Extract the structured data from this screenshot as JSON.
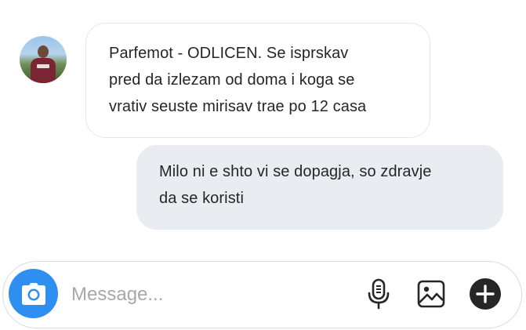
{
  "thread": {
    "messages": [
      {
        "direction": "incoming",
        "text": "Parfemot - ODLICEN. Se isprskav\npred da izlezam od doma i koga se\nvrativ seuste mirisav trae po 12 casa"
      },
      {
        "direction": "outgoing",
        "text": "Milo ni e shto vi se dopagja, so zdravje\nda se koristi"
      }
    ]
  },
  "composer": {
    "placeholder": "Message...",
    "value": ""
  },
  "icons": {
    "camera": "camera-icon",
    "microphone": "microphone-icon",
    "image": "image-icon",
    "add": "plus-circle-icon"
  },
  "colors": {
    "camera_button": "#2f8ff0",
    "outgoing_bubble": "#e9edf1",
    "incoming_border": "#e6e6e6",
    "placeholder": "#a8a8a8"
  }
}
